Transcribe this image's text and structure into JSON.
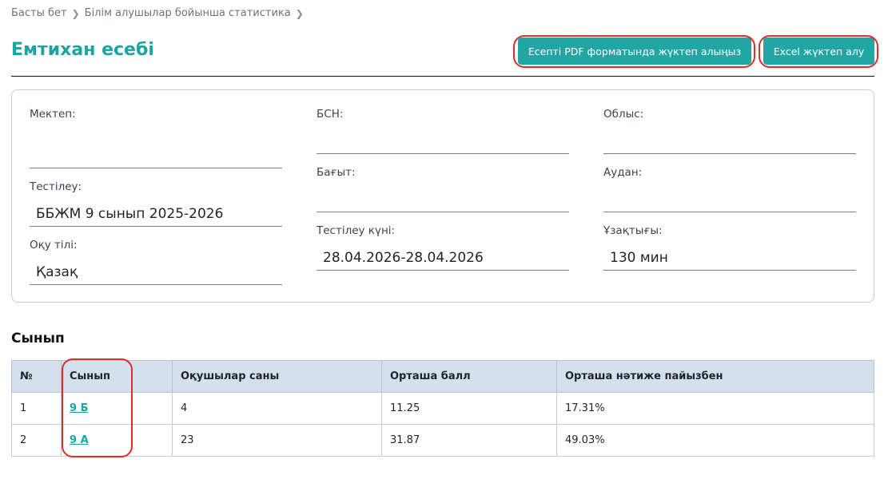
{
  "breadcrumb": {
    "home": "Басты бет",
    "current": "Білім алушылар бойынша статистика"
  },
  "page_title": "Емтихан есебі",
  "actions": {
    "pdf_label": "Есепті PDF форматында жүктеп алыңыз",
    "excel_label": "Excel жүктеп алу"
  },
  "info": {
    "school": {
      "label": "Мектеп:",
      "value": ""
    },
    "testing": {
      "label": "Тестілеу:",
      "value": "ББЖМ 9 сынып 2025-2026"
    },
    "language": {
      "label": "Оқу тілі:",
      "value": "Қазақ"
    },
    "bin": {
      "label": "БСН:",
      "value": ""
    },
    "direction": {
      "label": "Бағыт:",
      "value": ""
    },
    "test_date": {
      "label": "Тестілеу күні:",
      "value": "28.04.2026-28.04.2026"
    },
    "region": {
      "label": "Облыс:",
      "value": ""
    },
    "district": {
      "label": "Аудан:",
      "value": ""
    },
    "duration": {
      "label": "Ұзақтығы:",
      "value": "130 мин"
    }
  },
  "class_section": {
    "title": "Сынып",
    "columns": [
      "№",
      "Сынып",
      "Оқушылар саны",
      "Орташа балл",
      "Орташа нәтиже пайызбен"
    ],
    "rows": [
      {
        "num": "1",
        "class": "9 Б",
        "students": "4",
        "avg_score": "11.25",
        "avg_percent": "17.31%"
      },
      {
        "num": "2",
        "class": "9 А",
        "students": "23",
        "avg_score": "31.87",
        "avg_percent": "49.03%"
      }
    ]
  },
  "colors": {
    "accent": "#22a6a3",
    "title": "#1aa5a2",
    "table_header": "#d4e0ec",
    "highlight": "#e02b2b"
  }
}
